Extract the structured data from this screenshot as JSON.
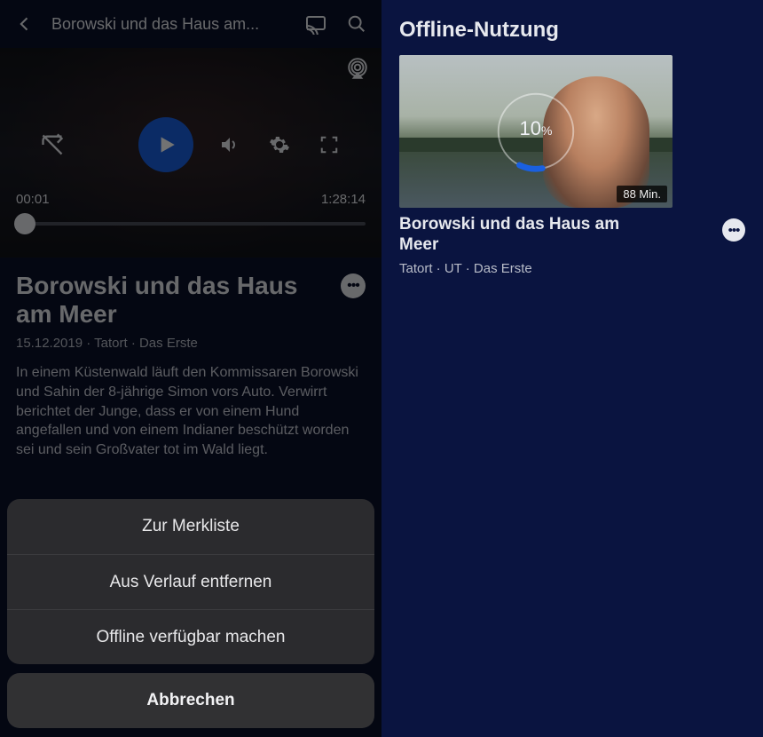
{
  "left": {
    "header_title": "Borowski und das Haus am...",
    "time_current": "00:01",
    "time_total": "1:28:14",
    "title": "Borowski und das Haus am Meer",
    "meta": "15.12.2019 · Tatort · Das Erste",
    "description": "In einem Küstenwald läuft den Kommissaren Borowski und Sahin der 8-jährige Simon vors Auto. Verwirrt berichtet der Junge, dass er von einem Hund angefallen und von einem Indianer beschützt worden sei und sein Großvater tot im Wald liegt.",
    "sheet": {
      "items": [
        "Zur Merkliste",
        "Aus Verlauf entfernen",
        "Offline verfügbar machen"
      ],
      "cancel": "Abbrechen"
    }
  },
  "right": {
    "header": "Offline-Nutzung",
    "item": {
      "progress_label": "10",
      "progress_unit": "%",
      "progress_fraction": 0.1,
      "duration": "88 Min.",
      "title": "Borowski und das Haus am Meer",
      "subtitle": "Tatort · UT · Das Erste"
    }
  }
}
